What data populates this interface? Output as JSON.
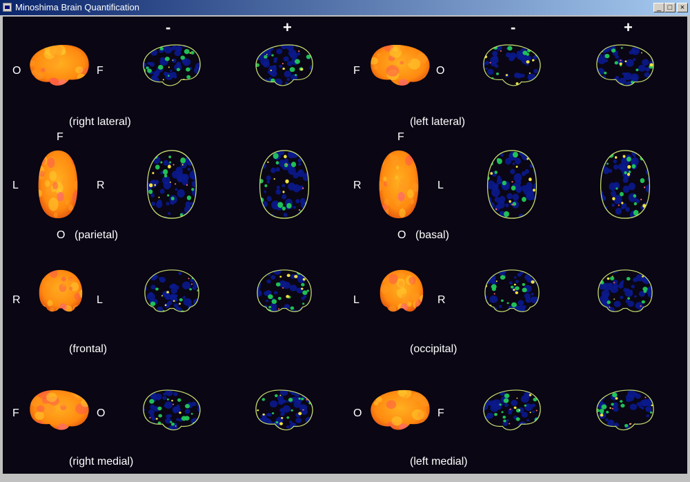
{
  "window": {
    "title": "Minoshima Brain Quantification"
  },
  "controls": {
    "minimize": "_",
    "maximize": "□",
    "close": "×"
  },
  "columns": {
    "minus_left": "-",
    "plus_left": "+",
    "minus_right": "-",
    "plus_right": "+"
  },
  "views": [
    {
      "caption": "(right lateral)",
      "orient": [
        "O",
        "F"
      ]
    },
    {
      "caption": "(left lateral)",
      "orient": [
        "F",
        "O"
      ]
    },
    {
      "caption": "(parietal)",
      "orient_top": "F",
      "orient_left": "L",
      "orient_right": "R",
      "orient_bottom": "O"
    },
    {
      "caption": "(basal)",
      "orient_top": "F",
      "orient_left": "R",
      "orient_right": "L",
      "orient_bottom": "O"
    },
    {
      "caption": "(frontal)",
      "orient": [
        "R",
        "L"
      ]
    },
    {
      "caption": "(occipital)",
      "orient": [
        "L",
        "R"
      ]
    },
    {
      "caption": "(right medial)",
      "orient": [
        "F",
        "O"
      ]
    },
    {
      "caption": "(left medial)",
      "orient": [
        "O",
        "F"
      ]
    }
  ],
  "colors": {
    "background": "#0a0614",
    "outline": "#c8e070",
    "low": "#0a1a8c",
    "mid": "#22c85a",
    "high": "#f0e040",
    "peak": "#ff6a6a"
  },
  "icons": {
    "app": "brain-app-icon"
  }
}
